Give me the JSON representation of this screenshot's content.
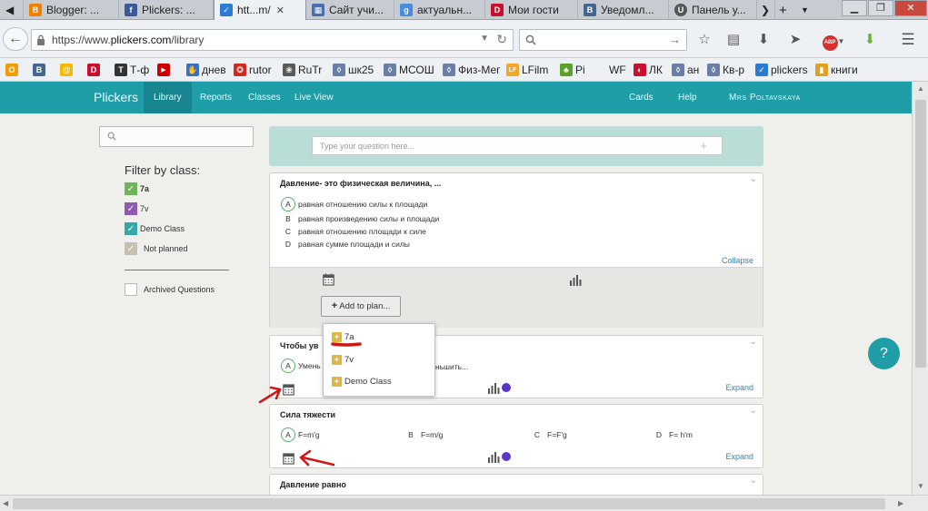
{
  "browser": {
    "tabs": [
      {
        "label": "Blogger: ...",
        "fav_color": "#f57d00",
        "fav_char": "B"
      },
      {
        "label": "Plickers: ...",
        "fav_color": "#3b5998",
        "fav_char": "f"
      },
      {
        "label": "htt...m/",
        "fav_color": "#2b7bd4",
        "fav_char": "✓",
        "active": true
      },
      {
        "label": "Сайт учи...",
        "fav_color": "#4a6fb0",
        "fav_char": "▦"
      },
      {
        "label": "актуальн...",
        "fav_color": "#4a8be0",
        "fav_char": "g"
      },
      {
        "label": "Мои гости",
        "fav_color": "#c8102e",
        "fav_char": "D"
      },
      {
        "label": "Уведомл...",
        "fav_color": "#45668e",
        "fav_char": "B"
      },
      {
        "label": "Панель у...",
        "fav_color": "#555555",
        "fav_char": "U"
      }
    ],
    "url_prefix": "https://www.",
    "url_host": "plickers.com",
    "url_path": "/library",
    "bookmarks": [
      {
        "label": "",
        "color": "#f59b00",
        "char": "О"
      },
      {
        "label": "",
        "color": "#45668e",
        "char": "B"
      },
      {
        "label": "",
        "color": "#f5b800",
        "char": "@"
      },
      {
        "label": "",
        "color": "#c8102e",
        "char": "D"
      },
      {
        "label": "Т-ф",
        "color": "#333333",
        "char": "T"
      },
      {
        "label": "",
        "color": "#cc0000",
        "char": "▶"
      },
      {
        "label": "днев",
        "color": "#3a6fc9",
        "char": "✋"
      },
      {
        "label": "rutor",
        "color": "#d02b1e",
        "char": "✪"
      },
      {
        "label": "RuTr",
        "color": "#5a5a5a",
        "char": "❀"
      },
      {
        "label": "шк25",
        "color": "#6b7ea8",
        "char": "◊"
      },
      {
        "label": "МСОШ",
        "color": "#6b7ea8",
        "char": "◊"
      },
      {
        "label": "Физ-Мег",
        "color": "#6b7ea8",
        "char": "◊"
      },
      {
        "label": "LFilm",
        "color": "#f5a623",
        "char": "LF"
      },
      {
        "label": "Pi",
        "color": "#5aa02c",
        "char": "♣"
      },
      {
        "label": "WF",
        "color": "#9aa0a6",
        "char": ""
      },
      {
        "label": "ЛК",
        "color": "#c8102e",
        "char": "◐"
      },
      {
        "label": "ан",
        "color": "#6b7ea8",
        "char": "◊"
      },
      {
        "label": "Кв-р",
        "color": "#6b7ea8",
        "char": "◊"
      },
      {
        "label": "plickers",
        "color": "#2b7bd4",
        "char": "✓"
      },
      {
        "label": "книги",
        "color": "#e0a020",
        "char": "▮"
      }
    ]
  },
  "app": {
    "brand": "Plickers",
    "nav": [
      "Library",
      "Reports",
      "Classes",
      "Live View"
    ],
    "nav_right": [
      "Cards",
      "Help",
      "Mrs Poltavskaya"
    ],
    "accent": "#1f9ea8"
  },
  "sidebar": {
    "filter_title": "Filter by class:",
    "classes": [
      {
        "label": "7a",
        "color": "#6fb35b"
      },
      {
        "label": "7v",
        "color": "#8e5ab0"
      },
      {
        "label": "Demo Class",
        "color": "#37a8a8"
      },
      {
        "label": "Not planned",
        "color": "#c7bfb0"
      }
    ],
    "archived_label": "Archived Questions"
  },
  "new_question": {
    "placeholder": "Type your question here...",
    "plus": "+"
  },
  "questions": [
    {
      "title": "Давление- это физическая величина, ...",
      "answers": [
        {
          "letter": "A",
          "text": "равная отношению силы к площади",
          "correct": true
        },
        {
          "letter": "B",
          "text": "равная произведению силы и площади"
        },
        {
          "letter": "C",
          "text": "равная отношению площади к силе"
        },
        {
          "letter": "D",
          "text": "равная сумме площади и силы"
        }
      ],
      "toggle": "Collapse",
      "add_plan": "Add to plan..."
    },
    {
      "title": "Чтобы ув",
      "answers": [
        {
          "letter": "A",
          "text": "Умень",
          "tail": "ньшить...",
          "correct": true
        }
      ],
      "toggle": "Expand"
    },
    {
      "title": "Сила тяжести",
      "answers": [
        {
          "letter": "A",
          "text": "F=m'g",
          "correct": true
        },
        {
          "letter": "B",
          "text": "F=m/g"
        },
        {
          "letter": "C",
          "text": "F=F'g"
        },
        {
          "letter": "D",
          "text": "F= h'm"
        }
      ],
      "toggle": "Expand"
    },
    {
      "title": "Давление равно",
      "answers": []
    }
  ],
  "plan_dropdown": {
    "items": [
      "7a",
      "7v",
      "Demo Class"
    ]
  },
  "annotation_color": "#d01515",
  "help_icon": "?"
}
